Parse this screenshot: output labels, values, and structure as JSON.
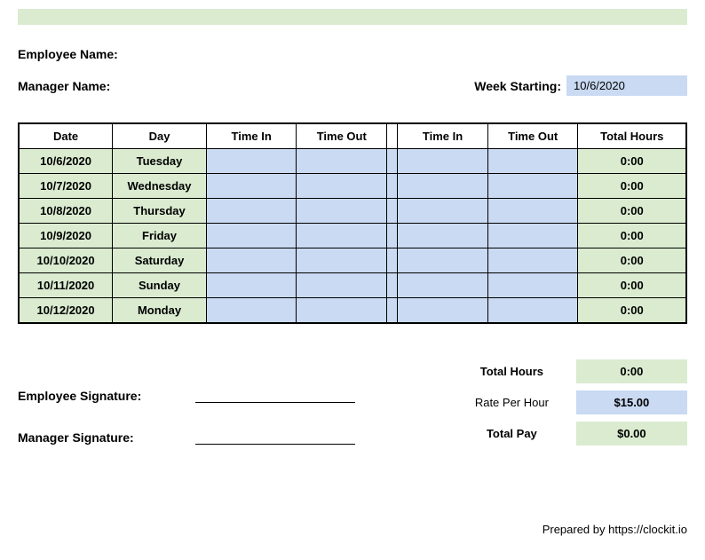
{
  "labels": {
    "employee_name": "Employee Name:",
    "manager_name": "Manager Name:",
    "week_starting": "Week Starting:",
    "employee_signature": "Employee Signature:",
    "manager_signature": "Manager Signature:",
    "prepared_by": "Prepared by https://clockit.io"
  },
  "week_starting_value": "10/6/2020",
  "headers": {
    "date": "Date",
    "day": "Day",
    "time_in": "Time In",
    "time_out": "Time Out",
    "total_hours": "Total Hours"
  },
  "rows": [
    {
      "date": "10/6/2020",
      "day": "Tuesday",
      "in1": "",
      "out1": "",
      "in2": "",
      "out2": "",
      "total": "0:00"
    },
    {
      "date": "10/7/2020",
      "day": "Wednesday",
      "in1": "",
      "out1": "",
      "in2": "",
      "out2": "",
      "total": "0:00"
    },
    {
      "date": "10/8/2020",
      "day": "Thursday",
      "in1": "",
      "out1": "",
      "in2": "",
      "out2": "",
      "total": "0:00"
    },
    {
      "date": "10/9/2020",
      "day": "Friday",
      "in1": "",
      "out1": "",
      "in2": "",
      "out2": "",
      "total": "0:00"
    },
    {
      "date": "10/10/2020",
      "day": "Saturday",
      "in1": "",
      "out1": "",
      "in2": "",
      "out2": "",
      "total": "0:00"
    },
    {
      "date": "10/11/2020",
      "day": "Sunday",
      "in1": "",
      "out1": "",
      "in2": "",
      "out2": "",
      "total": "0:00"
    },
    {
      "date": "10/12/2020",
      "day": "Monday",
      "in1": "",
      "out1": "",
      "in2": "",
      "out2": "",
      "total": "0:00"
    }
  ],
  "summary": {
    "total_hours_label": "Total Hours",
    "total_hours_value": "0:00",
    "rate_label": "Rate Per Hour",
    "rate_value": "$15.00",
    "total_pay_label": "Total Pay",
    "total_pay_value": "$0.00"
  }
}
